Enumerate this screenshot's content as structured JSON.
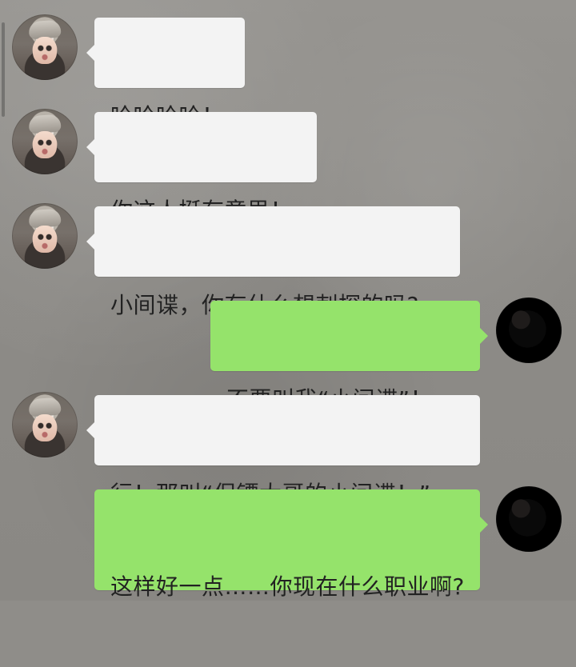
{
  "chat": {
    "messages": [
      {
        "side": "left",
        "text": "哈哈哈哈！"
      },
      {
        "side": "left",
        "text": "你这人挺有意思！"
      },
      {
        "side": "left",
        "text": "小间谍，你有什么想刺探的吗?"
      },
      {
        "side": "right",
        "text": "不要叫我“小间谍”！"
      },
      {
        "side": "left",
        "text": "行！那叫“保镖大哥的小间谍！”"
      },
      {
        "side": "right",
        "text": "这样好一点……你现在什么职业啊?"
      }
    ]
  },
  "colors": {
    "background": "#8f8d89",
    "incoming_bubble": "#f3f3f3",
    "outgoing_bubble": "#95e36b"
  },
  "icons": {
    "incoming_avatar": "user-avatar-icon",
    "outgoing_avatar": "user-avatar-icon"
  }
}
